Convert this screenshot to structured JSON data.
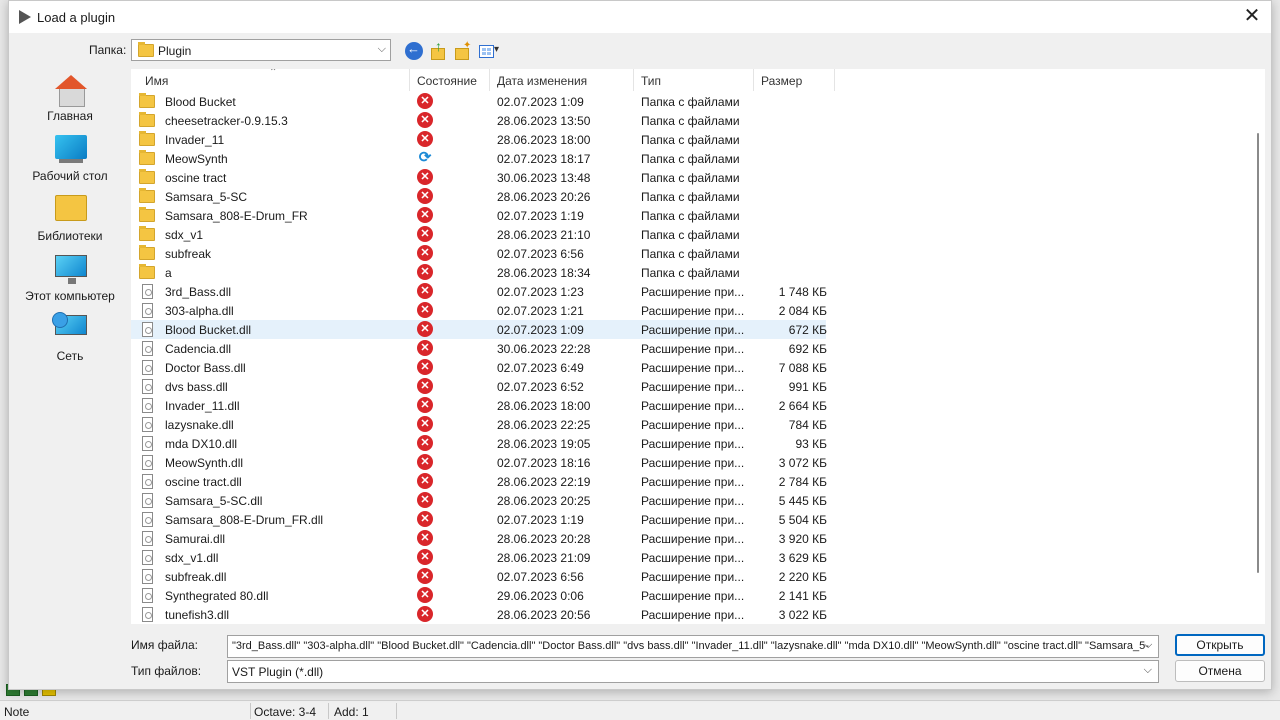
{
  "window": {
    "title": "Load a plugin",
    "close": "✕"
  },
  "lookin": {
    "label": "Папка:",
    "value": "Plugin"
  },
  "places": [
    "Главная",
    "Рабочий стол",
    "Библиотеки",
    "Этот компьютер",
    "Сеть"
  ],
  "columns": {
    "name": "Имя",
    "status": "Состояние",
    "date": "Дата изменения",
    "type": "Тип",
    "size": "Размер"
  },
  "files": [
    {
      "name": "Blood Bucket",
      "kind": "folder",
      "status": "error",
      "date": "02.07.2023 1:09",
      "type": "Папка с файлами",
      "size": ""
    },
    {
      "name": "cheesetracker-0.9.15.3",
      "kind": "folder",
      "status": "error",
      "date": "28.06.2023 13:50",
      "type": "Папка с файлами",
      "size": ""
    },
    {
      "name": "Invader_11",
      "kind": "folder",
      "status": "error",
      "date": "28.06.2023 18:00",
      "type": "Папка с файлами",
      "size": ""
    },
    {
      "name": "MeowSynth",
      "kind": "folder",
      "status": "sync",
      "date": "02.07.2023 18:17",
      "type": "Папка с файлами",
      "size": ""
    },
    {
      "name": "oscine tract",
      "kind": "folder",
      "status": "error",
      "date": "30.06.2023 13:48",
      "type": "Папка с файлами",
      "size": ""
    },
    {
      "name": "Samsara_5-SC",
      "kind": "folder",
      "status": "error",
      "date": "28.06.2023 20:26",
      "type": "Папка с файлами",
      "size": ""
    },
    {
      "name": "Samsara_808-E-Drum_FR",
      "kind": "folder",
      "status": "error",
      "date": "02.07.2023 1:19",
      "type": "Папка с файлами",
      "size": ""
    },
    {
      "name": "sdx_v1",
      "kind": "folder",
      "status": "error",
      "date": "28.06.2023 21:10",
      "type": "Папка с файлами",
      "size": ""
    },
    {
      "name": "subfreak",
      "kind": "folder",
      "status": "error",
      "date": "02.07.2023 6:56",
      "type": "Папка с файлами",
      "size": ""
    },
    {
      "name": "a",
      "kind": "folder",
      "status": "error",
      "date": "28.06.2023 18:34",
      "type": "Папка с файлами",
      "size": ""
    },
    {
      "name": "3rd_Bass.dll",
      "kind": "dll",
      "status": "error",
      "date": "02.07.2023 1:23",
      "type": "Расширение при...",
      "size": "1 748 КБ"
    },
    {
      "name": "303-alpha.dll",
      "kind": "dll",
      "status": "error",
      "date": "02.07.2023 1:21",
      "type": "Расширение при...",
      "size": "2 084 КБ"
    },
    {
      "name": "Blood Bucket.dll",
      "kind": "dll",
      "status": "error",
      "date": "02.07.2023 1:09",
      "type": "Расширение при...",
      "size": "672 КБ"
    },
    {
      "name": "Cadencia.dll",
      "kind": "dll",
      "status": "error",
      "date": "30.06.2023 22:28",
      "type": "Расширение при...",
      "size": "692 КБ"
    },
    {
      "name": "Doctor Bass.dll",
      "kind": "dll",
      "status": "error",
      "date": "02.07.2023 6:49",
      "type": "Расширение при...",
      "size": "7 088 КБ"
    },
    {
      "name": "dvs bass.dll",
      "kind": "dll",
      "status": "error",
      "date": "02.07.2023 6:52",
      "type": "Расширение при...",
      "size": "991 КБ"
    },
    {
      "name": "Invader_11.dll",
      "kind": "dll",
      "status": "error",
      "date": "28.06.2023 18:00",
      "type": "Расширение при...",
      "size": "2 664 КБ"
    },
    {
      "name": "lazysnake.dll",
      "kind": "dll",
      "status": "error",
      "date": "28.06.2023 22:25",
      "type": "Расширение при...",
      "size": "784 КБ"
    },
    {
      "name": "mda DX10.dll",
      "kind": "dll",
      "status": "error",
      "date": "28.06.2023 19:05",
      "type": "Расширение при...",
      "size": "93 КБ"
    },
    {
      "name": "MeowSynth.dll",
      "kind": "dll",
      "status": "error",
      "date": "02.07.2023 18:16",
      "type": "Расширение при...",
      "size": "3 072 КБ"
    },
    {
      "name": "oscine tract.dll",
      "kind": "dll",
      "status": "error",
      "date": "28.06.2023 22:19",
      "type": "Расширение при...",
      "size": "2 784 КБ"
    },
    {
      "name": "Samsara_5-SC.dll",
      "kind": "dll",
      "status": "error",
      "date": "28.06.2023 20:25",
      "type": "Расширение при...",
      "size": "5 445 КБ"
    },
    {
      "name": "Samsara_808-E-Drum_FR.dll",
      "kind": "dll",
      "status": "error",
      "date": "02.07.2023 1:19",
      "type": "Расширение при...",
      "size": "5 504 КБ"
    },
    {
      "name": "Samurai.dll",
      "kind": "dll",
      "status": "error",
      "date": "28.06.2023 20:28",
      "type": "Расширение при...",
      "size": "3 920 КБ"
    },
    {
      "name": "sdx_v1.dll",
      "kind": "dll",
      "status": "error",
      "date": "28.06.2023 21:09",
      "type": "Расширение при...",
      "size": "3 629 КБ"
    },
    {
      "name": "subfreak.dll",
      "kind": "dll",
      "status": "error",
      "date": "02.07.2023 6:56",
      "type": "Расширение при...",
      "size": "2 220 КБ"
    },
    {
      "name": "Synthegrated 80.dll",
      "kind": "dll",
      "status": "error",
      "date": "29.06.2023 0:06",
      "type": "Расширение при...",
      "size": "2 141 КБ"
    },
    {
      "name": "tunefish3.dll",
      "kind": "dll",
      "status": "error",
      "date": "28.06.2023 20:56",
      "type": "Расширение при...",
      "size": "3 022 КБ"
    }
  ],
  "selected_index": 12,
  "bottom": {
    "filename_label": "Имя файла:",
    "filename_value": "\"3rd_Bass.dll\" \"303-alpha.dll\" \"Blood Bucket.dll\" \"Cadencia.dll\" \"Doctor Bass.dll\" \"dvs bass.dll\" \"Invader_11.dll\" \"lazysnake.dll\" \"mda DX10.dll\" \"MeowSynth.dll\" \"oscine tract.dll\" \"Samsara_5-",
    "filetype_label": "Тип файлов:",
    "filetype_value": "VST Plugin (*.dll)",
    "open": "Открыть",
    "cancel": "Отмена"
  },
  "app_status": {
    "mode": "Note",
    "octave": "Octave: 3-4",
    "add": "Add: 1"
  },
  "colors": {
    "accent": "#0067c0",
    "error": "#d9262a",
    "selection": "#e5f1fb",
    "folder": "#f4c542"
  }
}
